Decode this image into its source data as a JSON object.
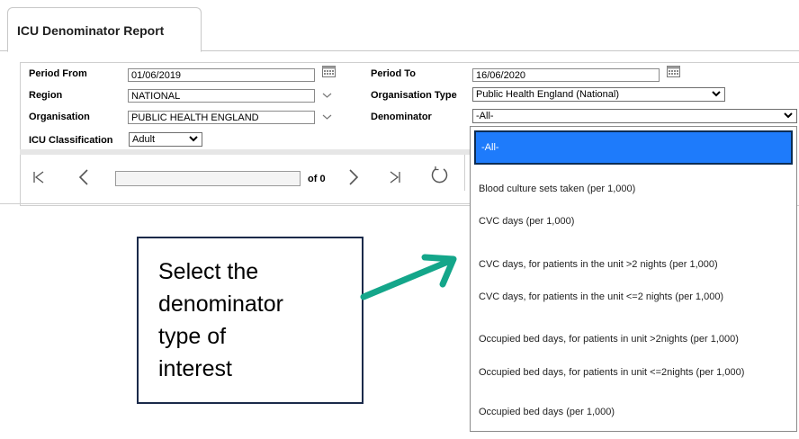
{
  "tab": {
    "title": "ICU Denominator Report"
  },
  "form": {
    "period_from": {
      "label": "Period From",
      "value": "01/06/2019"
    },
    "period_to": {
      "label": "Period To",
      "value": "16/06/2020"
    },
    "region": {
      "label": "Region",
      "value": "NATIONAL"
    },
    "organisation_type": {
      "label": "Organisation Type",
      "value": "Public Health England (National)"
    },
    "organisation": {
      "label": "Organisation",
      "value": "PUBLIC HEALTH ENGLAND"
    },
    "denominator": {
      "label": "Denominator",
      "value": "-All-"
    },
    "icu_classification": {
      "label": "ICU Classification",
      "value": "Adult"
    }
  },
  "pager": {
    "of_label": "of 0"
  },
  "denominator_options": [
    "-All-",
    "Blood culture sets taken (per 1,000)",
    "CVC days (per 1,000)",
    "CVC days, for patients in the unit >2 nights (per 1,000)",
    "CVC days, for patients in the unit <=2 nights (per 1,000)",
    "Occupied bed days, for patients in unit >2nights (per 1,000)",
    "Occupied bed days, for patients in unit <=2nights (per 1,000)",
    "Occupied bed days (per 1,000)"
  ],
  "callout": {
    "text": "Select the\ndenominator\ntype of\ninterest"
  },
  "colors": {
    "highlight": "#1e7bfb",
    "callout_border": "#1b2a4a",
    "arrow": "#14a68a"
  }
}
